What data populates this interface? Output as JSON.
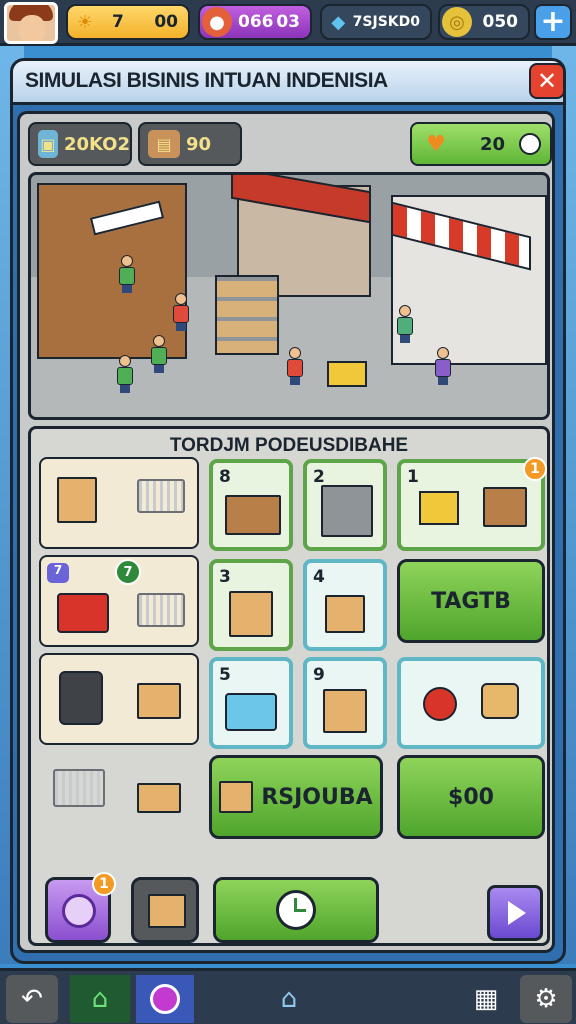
{
  "resources": {
    "sun": "7",
    "sun_extra": "00",
    "gems": "066",
    "gems_level": "03",
    "crystals": "7SJSKD0",
    "coins": "050"
  },
  "panel": {
    "title": "SIMULASI BISINIS INTUAN INDENISIA",
    "stats": {
      "goods": "20KO2",
      "stock": "90",
      "energy": "20"
    }
  },
  "shop": {
    "heading": "TORDJM PODEUSDIBAHE",
    "slots": [
      {
        "num": "8"
      },
      {
        "num": "2"
      },
      {
        "num": "1",
        "badge": "1"
      },
      {
        "num": "3"
      },
      {
        "num": "4"
      },
      {
        "num": "5"
      },
      {
        "num": "9"
      }
    ],
    "left_badge_a": "7",
    "left_badge_b": "7",
    "btn_trade": "TAGTB",
    "btn_restock": "RSJOUBA",
    "btn_price": "$00",
    "item_badge": "1"
  },
  "colors": {
    "accent_green": "#5ea448",
    "accent_blue": "#5fb7c5",
    "danger": "#e5432d"
  },
  "icons": [
    "sun-icon",
    "gem-icon",
    "crystal-icon",
    "coin-icon",
    "plus-icon",
    "close-icon",
    "box-icon",
    "clock-icon",
    "back-icon",
    "home-icon",
    "refresh-icon",
    "store-icon",
    "grid-icon",
    "gear-icon",
    "play-icon"
  ]
}
